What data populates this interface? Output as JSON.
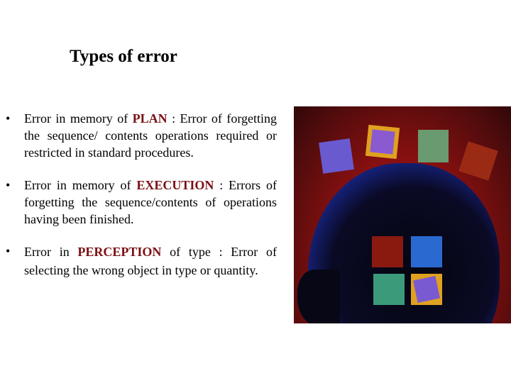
{
  "slide": {
    "title": "Types of error",
    "bullets": [
      {
        "prefix": "Error in memory of ",
        "keyword": "PLAN",
        "suffix": " : Error of forgetting the sequence/ contents operations required or restricted in standard procedures."
      },
      {
        "prefix": "Error in memory of ",
        "keyword": "EXECUTION",
        "suffix": " : Errors of forgetting the sequence/contents of operations having been finished."
      },
      {
        "prefix": "Error in ",
        "keyword": "PERCEPTION",
        "suffix": " of type : Error of selecting the wrong object in type or quantity."
      }
    ],
    "bullet_glyph": "•",
    "keyword_color": "#7a0f14",
    "image": {
      "description": "head-silhouette-with-memory-cards-illustration"
    }
  }
}
